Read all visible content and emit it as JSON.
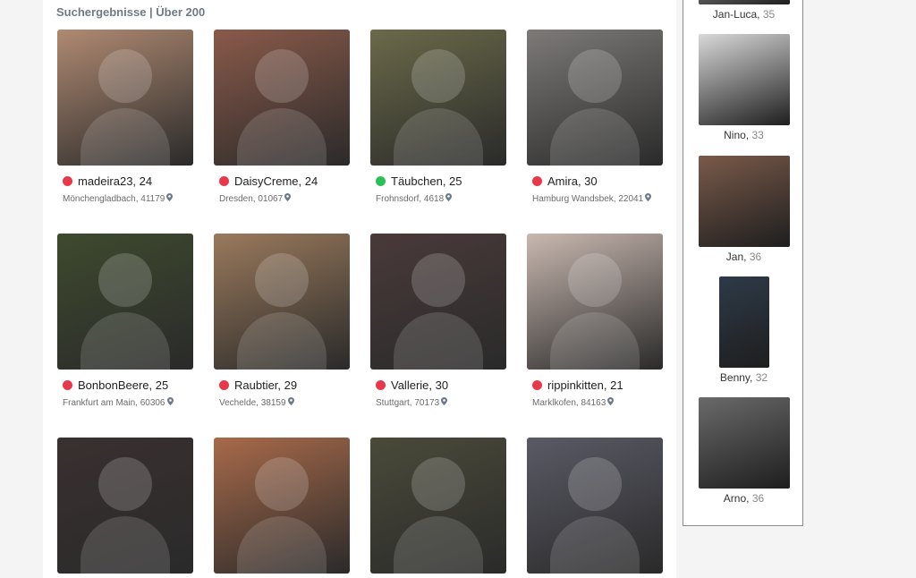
{
  "results": {
    "header": "Suchergebnisse | Über 200",
    "profiles": [
      {
        "name": "madeira23, 24",
        "location": "Mönchengladbach, 41179",
        "status": "offline",
        "color": "#b08a72"
      },
      {
        "name": "DaisyCreme, 24",
        "location": "Dresden, 01067",
        "status": "offline",
        "color": "#8a5a4a"
      },
      {
        "name": "Täubchen, 25",
        "location": "Frohnsdorf, 4618",
        "status": "online",
        "color": "#6b6a4a"
      },
      {
        "name": "Amira, 30",
        "location": "Hamburg Wandsbek, 22041",
        "status": "offline",
        "color": "#7d7a78"
      },
      {
        "name": "BonbonBeere, 25",
        "location": "Frankfurt am Main, 60306",
        "status": "offline",
        "color": "#3e4a2e"
      },
      {
        "name": "Raubtier, 29",
        "location": "Vechelde, 38159",
        "status": "offline",
        "color": "#9a7a5c"
      },
      {
        "name": "Vallerie, 30",
        "location": "Stuttgart, 70173",
        "status": "offline",
        "color": "#4a3a3a"
      },
      {
        "name": "rippinkitten, 21",
        "location": "Marklkofen, 84163",
        "status": "offline",
        "color": "#c9b8b0"
      },
      {
        "name": "",
        "location": "",
        "status": "",
        "color": "#3a3030"
      },
      {
        "name": "",
        "location": "",
        "status": "",
        "color": "#a86a4a"
      },
      {
        "name": "",
        "location": "",
        "status": "",
        "color": "#4a4a3a"
      },
      {
        "name": "",
        "location": "",
        "status": "",
        "color": "#5a5a66"
      }
    ]
  },
  "sidebar": {
    "items": [
      {
        "name": "Jan-Luca",
        "age": "35",
        "color": "#8a8a8a"
      },
      {
        "name": "Nino",
        "age": "33",
        "color": "#d9d9d9"
      },
      {
        "name": "Jan",
        "age": "36",
        "color": "#7a5a4a"
      },
      {
        "name": "Benny",
        "age": "32",
        "color": "#2e3a48"
      },
      {
        "name": "Arno",
        "age": "36",
        "color": "#6a6a6a"
      }
    ]
  }
}
